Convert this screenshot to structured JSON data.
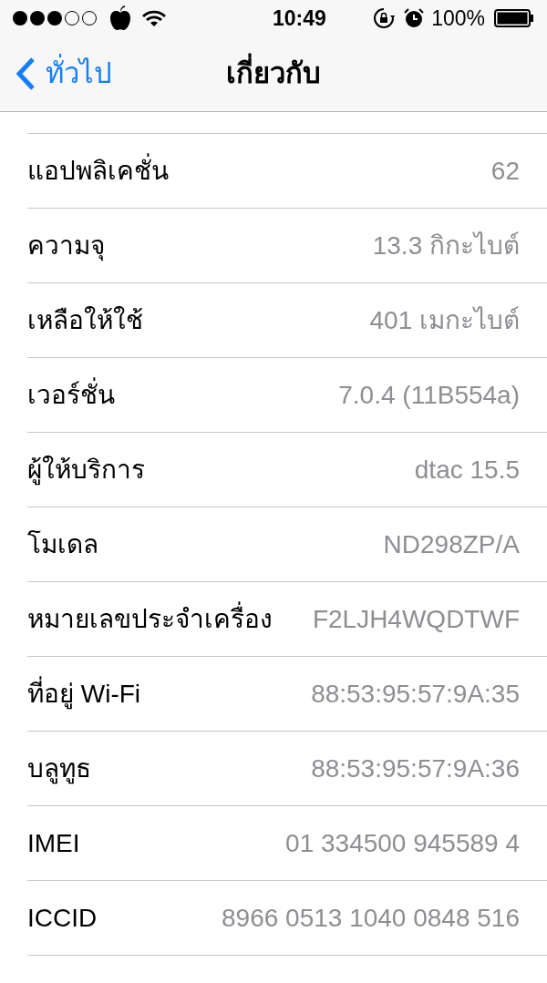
{
  "status_bar": {
    "signal": [
      {
        "filled": true
      },
      {
        "filled": true
      },
      {
        "filled": true
      },
      {
        "filled": false
      },
      {
        "filled": false
      }
    ],
    "time": "10:49",
    "battery_percent": "100%"
  },
  "nav_bar": {
    "back": "ทั่วไป",
    "title": "เกี่ยวกับ"
  },
  "rows": [
    {
      "label": "แอปพลิเคชั่น",
      "value": "62"
    },
    {
      "label": "ความจุ",
      "value": "13.3 กิกะไบต์"
    },
    {
      "label": "เหลือให้ใช้",
      "value": "401 เมกะไบต์"
    },
    {
      "label": "เวอร์ชั่น",
      "value": "7.0.4 (11B554a)"
    },
    {
      "label": "ผู้ให้บริการ",
      "value": "dtac 15.5"
    },
    {
      "label": "โมเดล",
      "value": "ND298ZP/A"
    },
    {
      "label": "หมายเลขประจำเครื่อง",
      "value": "F2LJH4WQDTWF"
    },
    {
      "label": "ที่อยู่ Wi-Fi",
      "value": "88:53:95:57:9A:35"
    },
    {
      "label": "บลูทูธ",
      "value": "88:53:95:57:9A:36"
    },
    {
      "label": "IMEI",
      "value": "01 334500 945589 4"
    },
    {
      "label": "ICCID",
      "value": "8966 0513 1040 0848 516"
    }
  ]
}
